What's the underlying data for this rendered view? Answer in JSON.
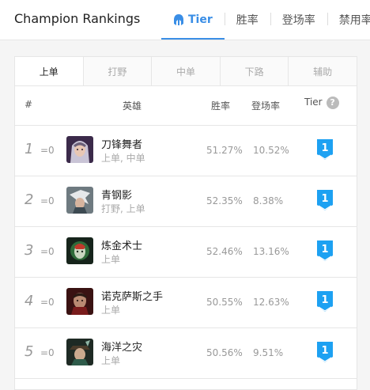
{
  "header": {
    "title": "Champion Rankings",
    "tabs": [
      {
        "label": "Tier",
        "active": true,
        "icon": "tier-helmet-icon"
      },
      {
        "label": "胜率",
        "active": false
      },
      {
        "label": "登场率",
        "active": false
      },
      {
        "label": "禁用率",
        "active": false
      }
    ]
  },
  "lanes": [
    "上单",
    "打野",
    "中单",
    "下路",
    "辅助"
  ],
  "columns": {
    "rank": "#",
    "champion": "英雄",
    "win_rate": "胜率",
    "pick_rate": "登场率",
    "tier": "Tier",
    "help": "?"
  },
  "rows": [
    {
      "rank": "1",
      "change": "=0",
      "name": "刀锋舞者",
      "positions": "上单, 中单",
      "win_rate": "51.27%",
      "pick_rate": "10.52%",
      "tier": "1"
    },
    {
      "rank": "2",
      "change": "=0",
      "name": "青钢影",
      "positions": "打野, 上单",
      "win_rate": "52.35%",
      "pick_rate": "8.38%",
      "tier": "1"
    },
    {
      "rank": "3",
      "change": "=0",
      "name": "炼金术士",
      "positions": "上单",
      "win_rate": "52.46%",
      "pick_rate": "13.16%",
      "tier": "1"
    },
    {
      "rank": "4",
      "change": "=0",
      "name": "诺克萨斯之手",
      "positions": "上单",
      "win_rate": "50.55%",
      "pick_rate": "12.63%",
      "tier": "1"
    },
    {
      "rank": "5",
      "change": "=0",
      "name": "海洋之灾",
      "positions": "上单",
      "win_rate": "50.56%",
      "pick_rate": "9.51%",
      "tier": "1"
    }
  ],
  "colors": {
    "accent": "#3a8ee6",
    "tier_badge": "#1da1f2"
  }
}
